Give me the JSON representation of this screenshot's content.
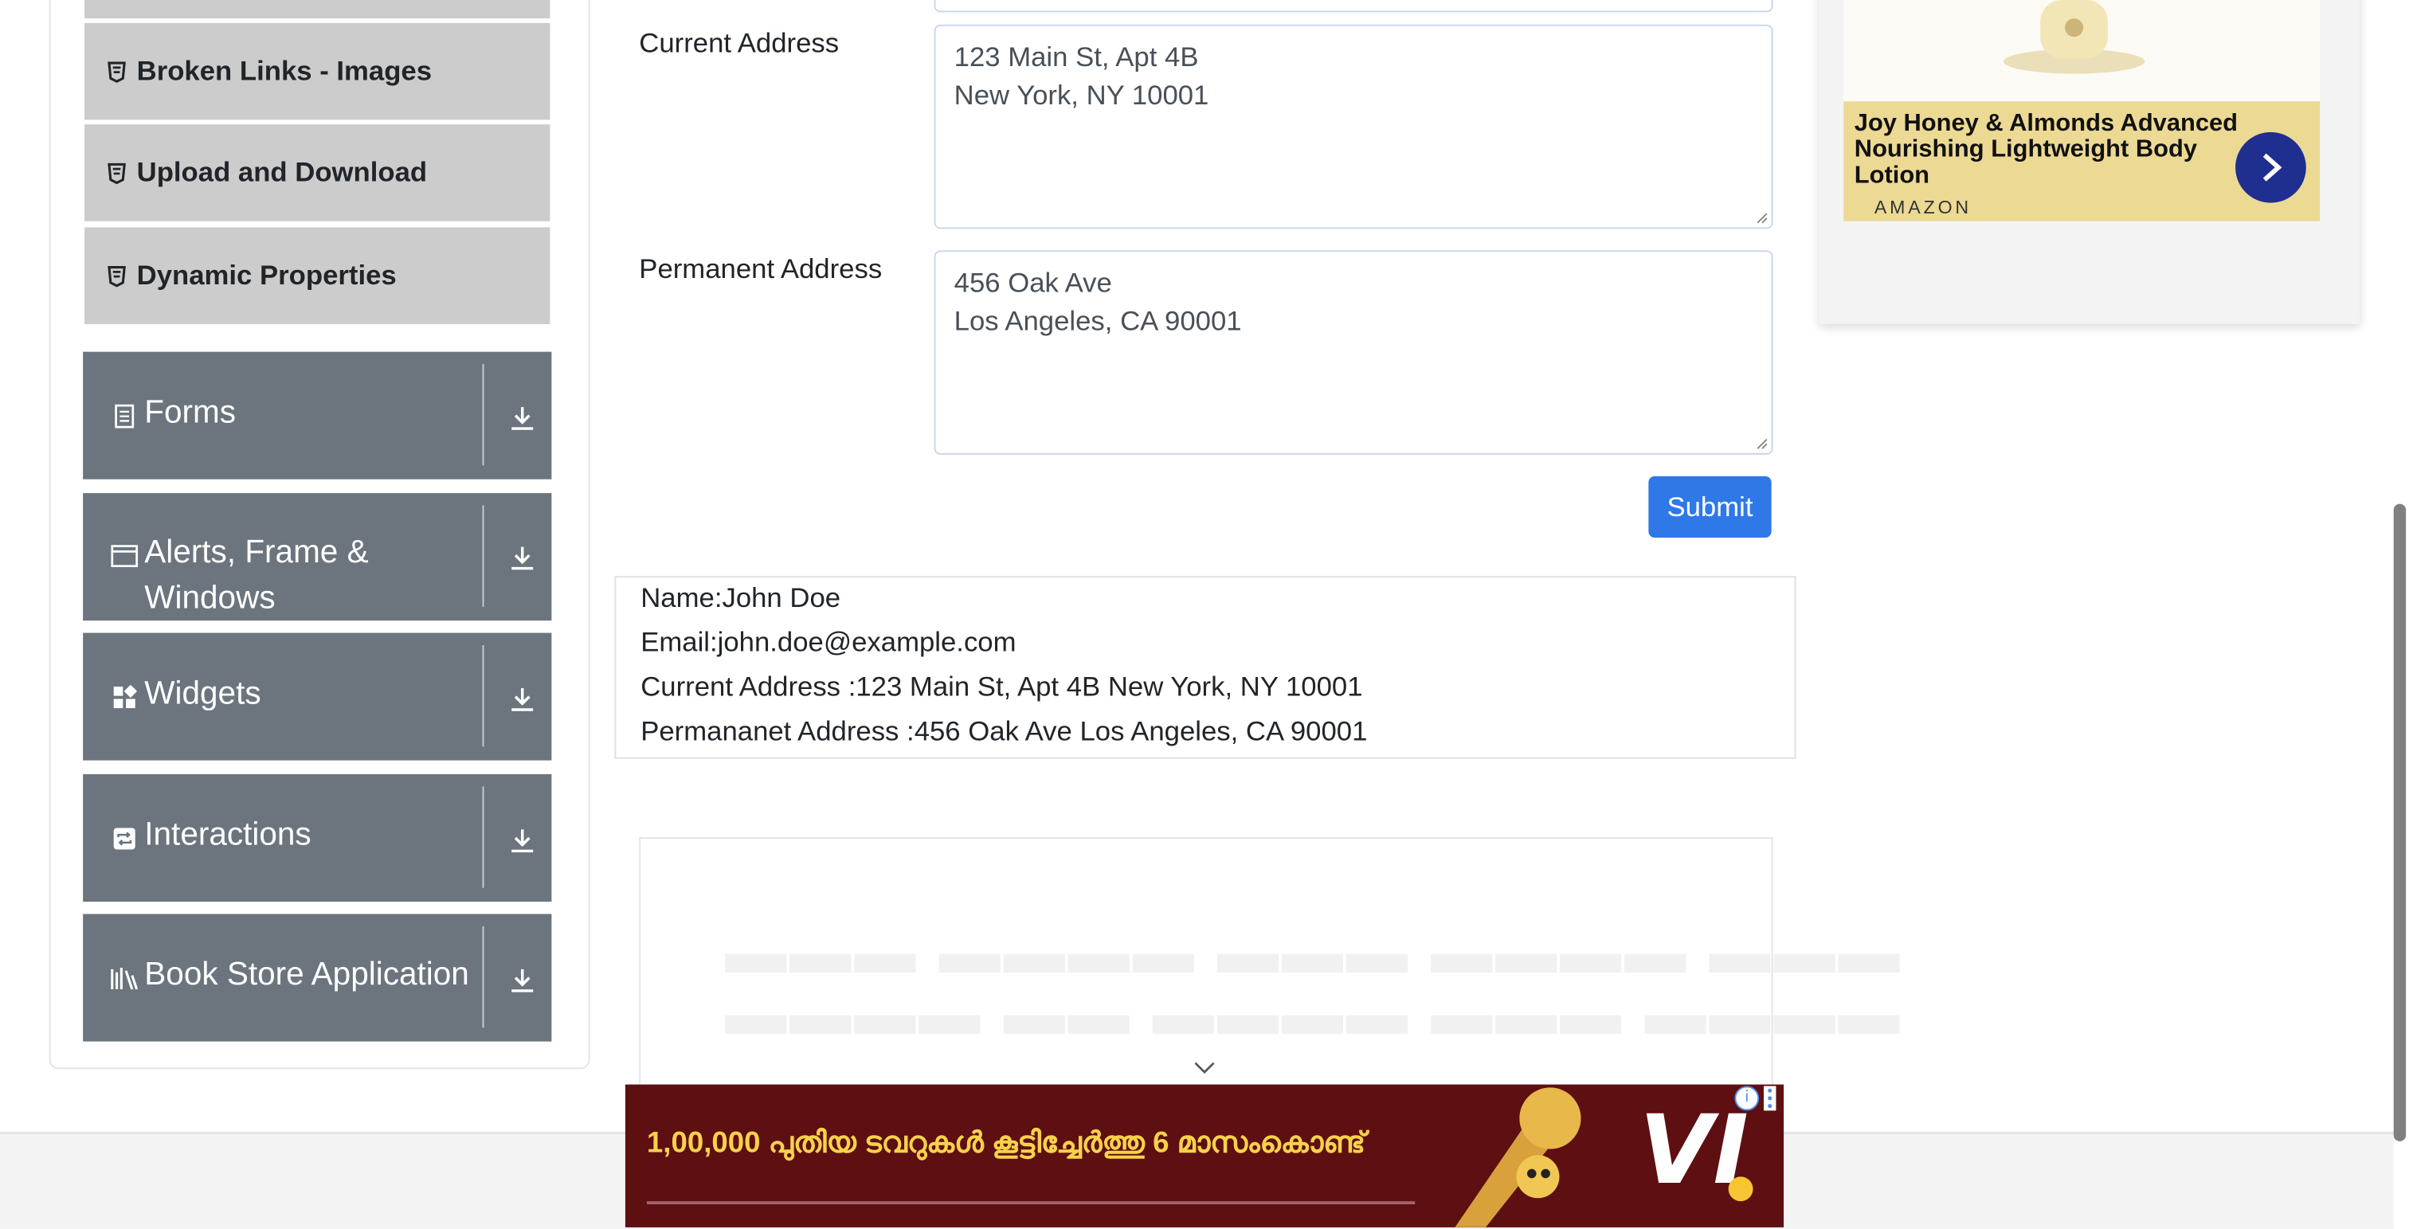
{
  "sidebar": {
    "sub_items": [
      {
        "label": "Broken Links - Images"
      },
      {
        "label": "Upload and Download"
      },
      {
        "label": "Dynamic Properties"
      }
    ],
    "groups": [
      {
        "label": "Forms",
        "icon": "document-icon"
      },
      {
        "label_line1": "Alerts, Frame &",
        "label_line2": "Windows",
        "icon": "window-icon"
      },
      {
        "label": "Widgets",
        "icon": "widgets-icon"
      },
      {
        "label": "Interactions",
        "icon": "interactions-icon"
      },
      {
        "label": "Book Store Application",
        "icon": "books-icon"
      }
    ]
  },
  "form": {
    "current_address_label": "Current Address",
    "current_address_line1": "123 Main St, Apt 4B",
    "current_address_line2": "New York, NY 10001",
    "permanent_address_label": "Permanent Address",
    "permanent_address_line1": "456 Oak Ave",
    "permanent_address_line2": "Los Angeles, CA 90001",
    "submit_label": "Submit"
  },
  "output": {
    "name": "Name:John Doe",
    "email": "Email:john.doe@example.com",
    "current_address": "Current Address :123 Main St, Apt 4B New York, NY 10001",
    "permanent_address": "Permananet Address :456 Oak Ave Los Angeles, CA 90001"
  },
  "right_ad": {
    "title": "Joy Honey & Almonds Advanced Nourishing Lightweight Body Lotion",
    "brand": "AMAZON"
  },
  "bottom_ad": {
    "headline": "1,00,000 പുതിയ ടവറുകൾ കൂട്ടിച്ചേർത്തു 6 മാസംകൊണ്ട്",
    "logo": "VI"
  },
  "colors": {
    "submit": "#2f78e8",
    "group_bg": "#6c757d",
    "sub_item_bg": "#cccccc"
  }
}
